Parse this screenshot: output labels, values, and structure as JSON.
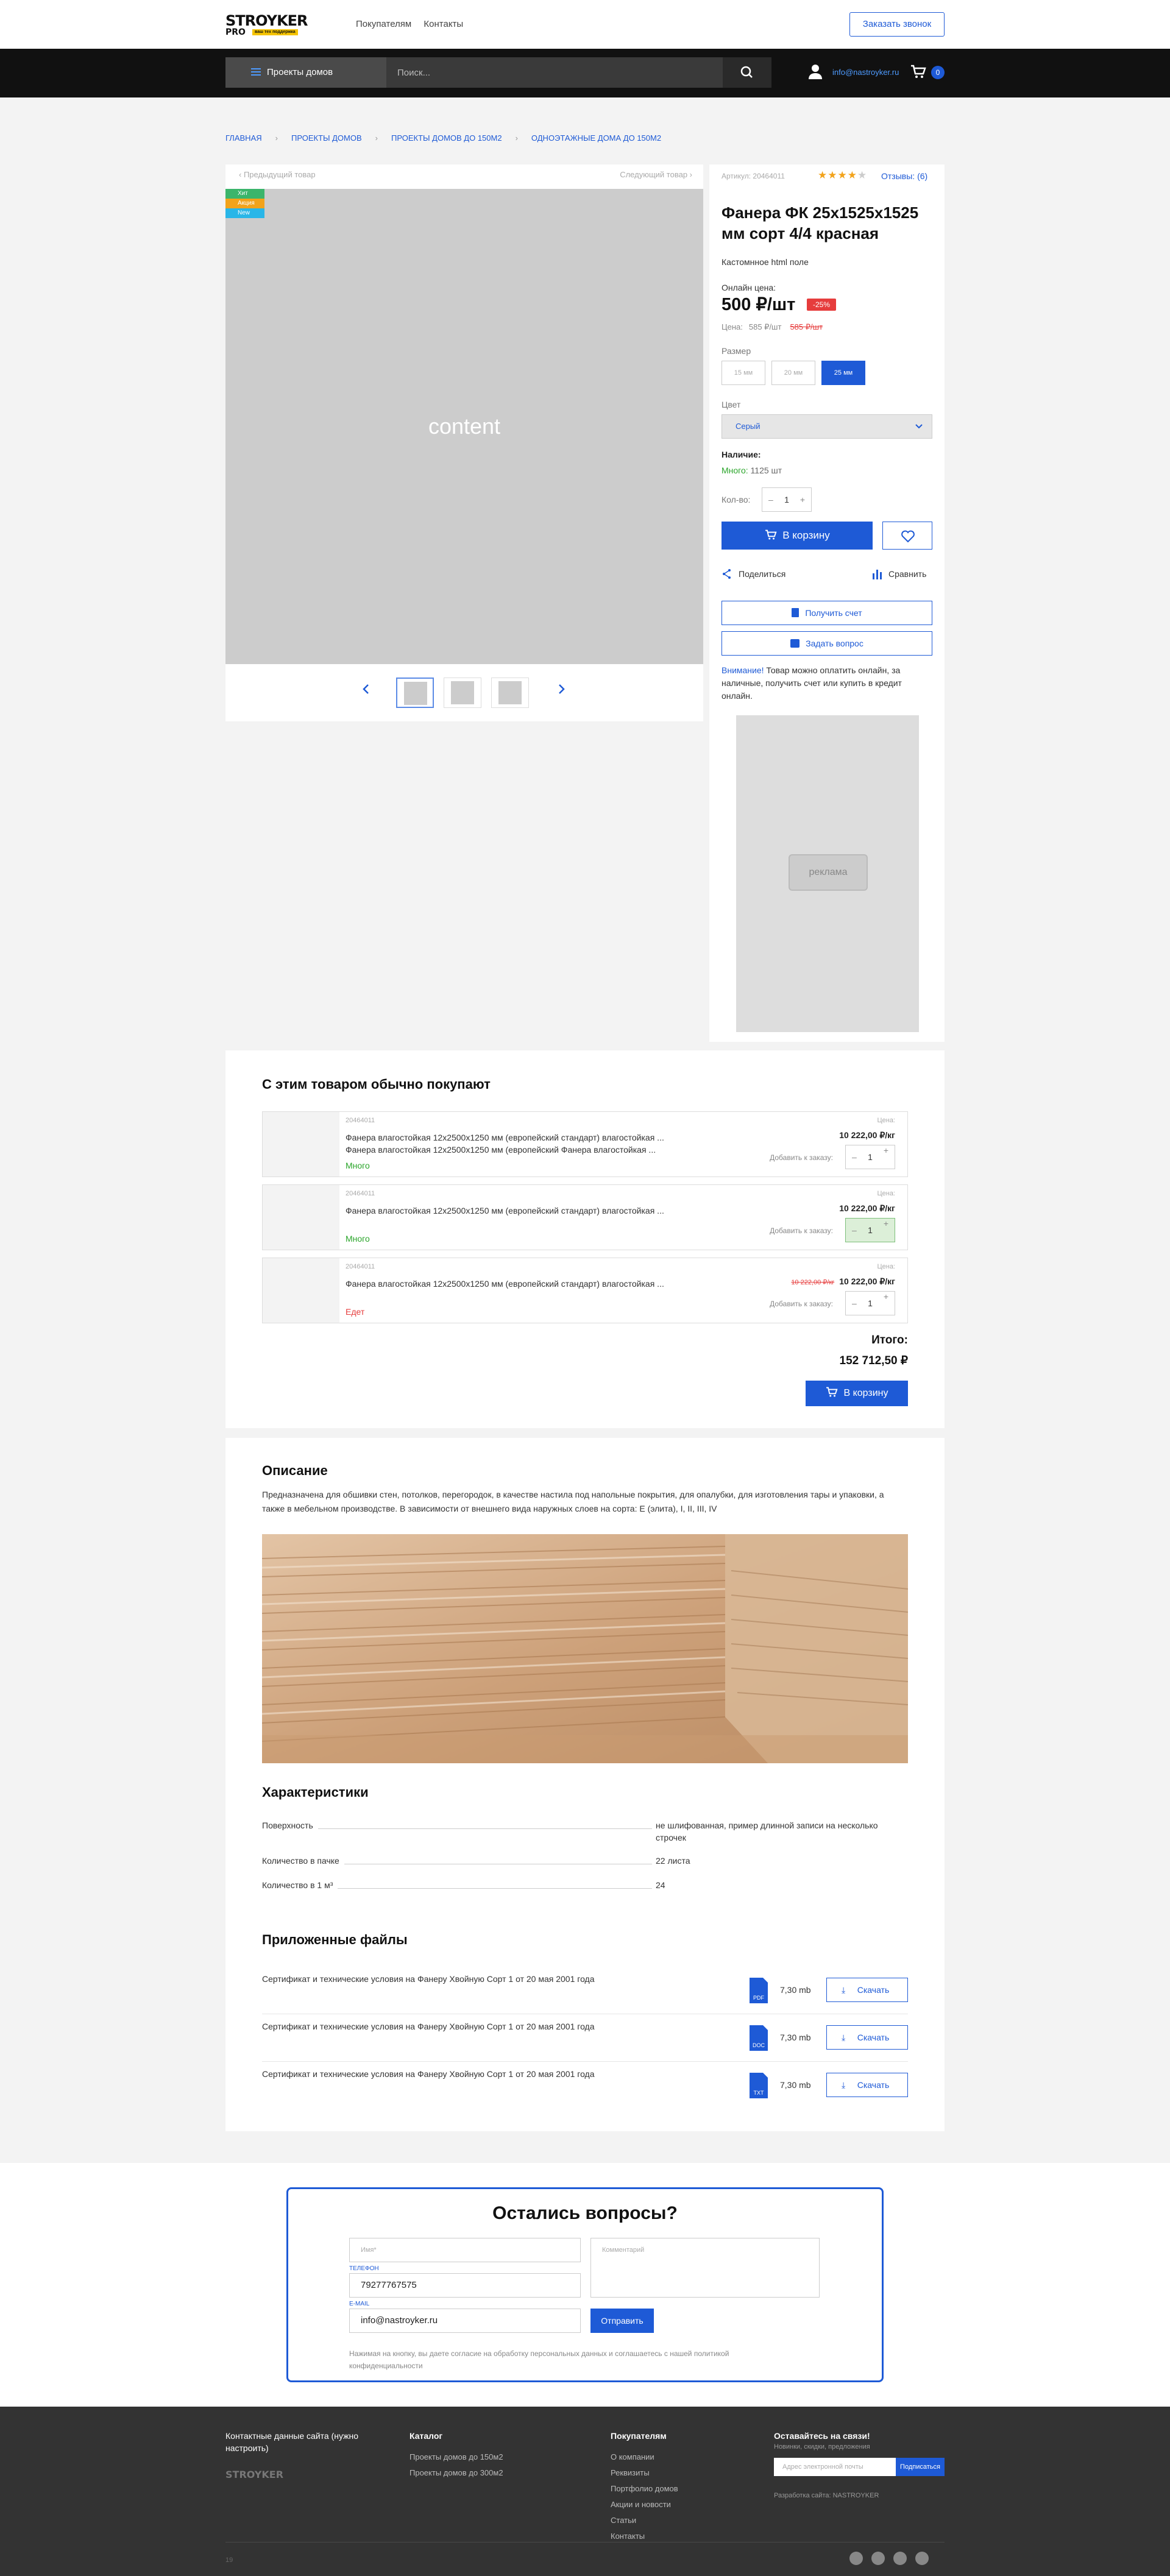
{
  "header": {
    "logo_main": "STROYKER",
    "logo_sub": "PRO",
    "logo_tag": "ваш тех поддержка",
    "links": [
      "Покупателям",
      "Контакты"
    ],
    "call_button": "Заказать звонок"
  },
  "nav": {
    "catalog_button": "Проекты домов",
    "search_placeholder": "Поиск...",
    "email": "info@nastroyker.ru",
    "cart_count": "0"
  },
  "breadcrumbs": [
    "ГЛАВНАЯ",
    "ПРОЕКТЫ ДОМОВ",
    "ПРОЕКТЫ ДОМОВ ДО 150М2",
    "ОДНОЭТАЖНЫЕ ДОМА ДО 150М2"
  ],
  "gallery": {
    "prev": "Предыдущий товар",
    "next": "Следующий товар",
    "placeholder": "content",
    "tags": [
      {
        "label": "Хит",
        "color": "#3bb56b"
      },
      {
        "label": "Акция",
        "color": "#f2a31b"
      },
      {
        "label": "New",
        "color": "#29b6e8"
      }
    ]
  },
  "product": {
    "article": "Артикул: 20464011",
    "rating": 3.5,
    "reviews": "Отзывы: (6)",
    "title": "Фанера ФК 25х1525х1525 мм сорт 4/4 красная",
    "custom_html": "Кастомнное html поле",
    "online_label": "Онлайн цена:",
    "price": "500 ₽/шт",
    "discount": "-25%",
    "price_label": "Цена:",
    "price_regular": "585 ₽/шт",
    "price_old": "585 ₽/шт",
    "size_label": "Размер",
    "sizes": [
      "15 мм",
      "20 мм",
      "25 мм"
    ],
    "selected_size": "25 мм",
    "color_label": "Цвет",
    "color_value": "Серый",
    "availability_label": "Наличие:",
    "availability_status": "Много:",
    "availability_qty": "1125 шт",
    "qty_label": "Кол-во:",
    "qty": "1",
    "cart_button": "В корзину",
    "share": "Поделиться",
    "compare": "Сравнить",
    "invoice_button": "Получить счет",
    "question_button": "Задать вопрос",
    "note_accent": "Внимание!",
    "note_text": " Товар можно оплатить онлайн, за наличные, получить счет или купить в кредит онлайн.",
    "ad_label": "реклама"
  },
  "together": {
    "title": "С этим товаром обычно покупают",
    "items": [
      {
        "code": "20464011",
        "name": "Фанера влагостойкая 12х2500х1250 мм (европейский стандарт) влагостойкая ... Фанера влагостойкая 12х2500х1250 мм (европейский Фанера влагостойкая ...",
        "status": "Много",
        "status_color": "#2aa52a",
        "price_label": "Цена:",
        "price": "10 222,00 ₽/кг",
        "old_price": "",
        "add_label": "Добавить к заказу:",
        "qty": "1",
        "highlight": false
      },
      {
        "code": "20464011",
        "name": "Фанера влагостойкая 12х2500х1250 мм (европейский стандарт) влагостойкая ...",
        "status": "Много",
        "status_color": "#2aa52a",
        "price_label": "Цена:",
        "price": "10 222,00 ₽/кг",
        "old_price": "",
        "add_label": "Добавить к заказу:",
        "qty": "1",
        "highlight": true
      },
      {
        "code": "20464011",
        "name": "Фанера влагостойкая 12х2500х1250 мм (европейский стандарт) влагостойкая ...",
        "status": "Едет",
        "status_color": "#e63c3c",
        "price_label": "Цена:",
        "price": "10 222,00 ₽/кг",
        "old_price": "10 222,00 ₽/кг",
        "add_label": "Добавить к заказу:",
        "qty": "1",
        "highlight": false
      }
    ],
    "total_label": "Итого:",
    "total": "152 712,50 ₽",
    "cart_button": "В корзину"
  },
  "description": {
    "title": "Описание",
    "text": "Предназначена для обшивки стен, потолков, перегородок, в качестве настила под напольные покрытия, для опалубки, для изготовления тары и упаковки, а также в мебельном производстве. В зависимости от внешнего вида наружных слоев на сорта: Е (элита), I, II, III, IV",
    "specs_title": "Характеристики",
    "specs": [
      {
        "k": "Поверхность",
        "v": "не шлифованная, пример длинной записи на несколько строчек"
      },
      {
        "k": "Количество в пачке",
        "v": "22 листа"
      },
      {
        "k": "Количество в 1 м³",
        "v": "24"
      }
    ],
    "files_title": "Приложенные файлы",
    "files": [
      {
        "name": "Сертификат и технические условия на Фанеру Хвойную Сорт 1 от 20 мая 2001 года",
        "ext": "PDF",
        "size": "7,30 mb",
        "button": "Скачать"
      },
      {
        "name": "Сертификат и технические условия на Фанеру Хвойную Сорт 1 от 20 мая 2001 года",
        "ext": "DOC",
        "size": "7,30 mb",
        "button": "Скачать"
      },
      {
        "name": "Сертификат и технические условия на Фанеру Хвойную Сорт 1 от 20 мая 2001 года",
        "ext": "TXT",
        "size": "7,30 mb",
        "button": "Скачать"
      }
    ]
  },
  "questions": {
    "title": "Остались вопросы?",
    "name_placeholder": "Имя*",
    "phone_label": "ТЕЛЕФОН",
    "phone": "79277767575",
    "email_label": "E-MAIL",
    "email": "info@nastroyker.ru",
    "comment_placeholder": "Комментарий",
    "send": "Отправить",
    "policy": "Нажимая на кнопку, вы даете согласие на обработку персональных данных и соглашаетесь с нашей политикой конфиденциальности"
  },
  "footer": {
    "contacts": "Контактные данные сайта (нужно настроить)",
    "logo": "STROYKER",
    "catalog_title": "Каталог",
    "catalog_links": [
      "Проекты домов до 150м2",
      "Проекты домов до 300м2"
    ],
    "buyers_title": "Покупателям",
    "buyers_links": [
      "О компании",
      "Реквизиты",
      "Портфолио домов",
      "Акции и новости",
      "Статьи",
      "Контакты"
    ],
    "news_title": "Оставайтесь на связи!",
    "news_sub": "Новинки, скидки, предложения",
    "news_placeholder": "Адрес электронной почты",
    "news_button": "Подписаться",
    "developer": "Разработка сайта: NASTROYKER",
    "year": "19"
  }
}
